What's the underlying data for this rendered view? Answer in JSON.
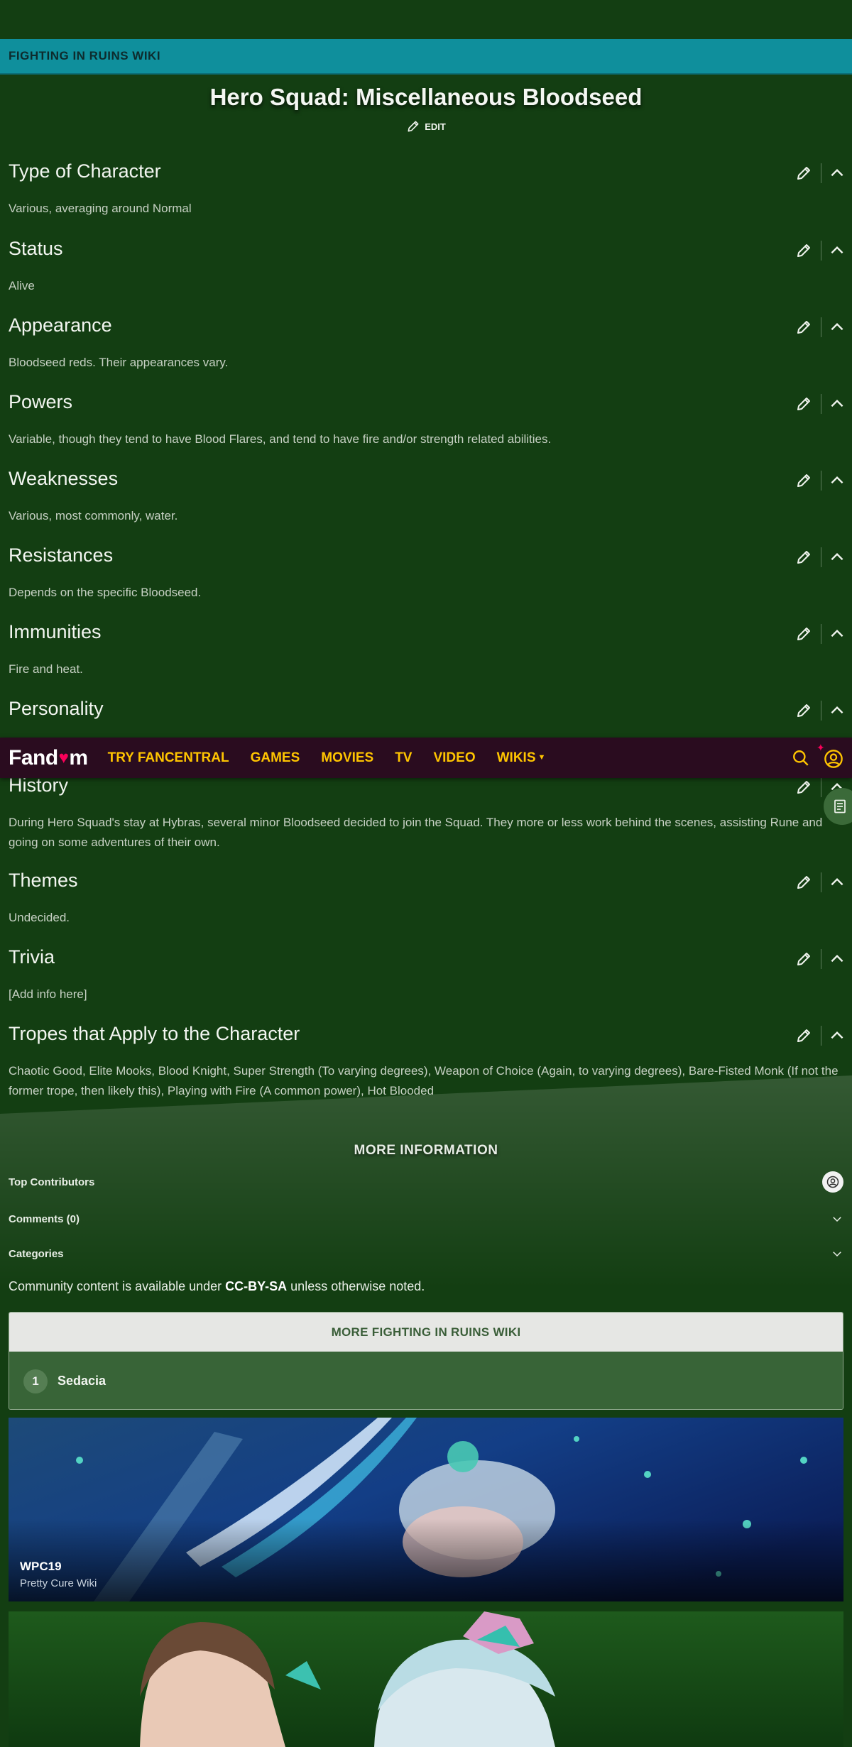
{
  "wiki": {
    "name": "FIGHTING IN RUINS WIKI"
  },
  "page": {
    "title": "Hero Squad: Miscellaneous Bloodseed",
    "edit_label": "EDIT"
  },
  "sections": [
    {
      "title": "Type of Character",
      "body": "Various, averaging around Normal"
    },
    {
      "title": "Status",
      "body": "Alive"
    },
    {
      "title": "Appearance",
      "body": "Bloodseed reds. Their appearances vary."
    },
    {
      "title": "Powers",
      "body": "Variable, though they tend to have Blood Flares, and tend to have fire and/or strength related abilities."
    },
    {
      "title": "Weaknesses",
      "body": "Various, most commonly, water."
    },
    {
      "title": "Resistances",
      "body": "Depends on the specific Bloodseed."
    },
    {
      "title": "Immunities",
      "body": "Fire and heat."
    },
    {
      "title": "Personality",
      "body": ""
    },
    {
      "title": "History",
      "body": "During Hero Squad's stay at Hybras, several minor Bloodseed decided to join the Squad. They more or less work behind the scenes, assisting Rune and going on some adventures of their own."
    },
    {
      "title": "Themes",
      "body": "Undecided."
    },
    {
      "title": "Trivia",
      "body": "[Add info here]"
    },
    {
      "title": "Tropes that Apply to the Character",
      "body": "Chaotic Good, Elite Mooks, Blood Knight, Super Strength (To varying degrees), Weapon of Choice (Again, to varying degrees), Bare-Fisted Monk (If not the former trope, then likely this), Playing with Fire (A common power), Hot Blooded"
    }
  ],
  "fandom_nav": {
    "logo_left": "Fand",
    "logo_right": "m",
    "items": [
      "TRY FANCENTRAL",
      "GAMES",
      "MOVIES",
      "TV",
      "VIDEO",
      "WIKIS"
    ]
  },
  "more_info": {
    "heading": "MORE INFORMATION",
    "top_contributors": "Top Contributors",
    "comments": "Comments (0)",
    "categories": "Categories"
  },
  "license": {
    "prefix": "Community content is available under ",
    "link": "CC-BY-SA",
    "suffix": " unless otherwise noted."
  },
  "more_wiki": {
    "heading": "MORE FIGHTING IN RUINS WIKI",
    "items": [
      {
        "number": "1",
        "label": "Sedacia"
      }
    ]
  },
  "cards": [
    {
      "title": "WPC19",
      "subtitle": "Pretty Cure Wiki"
    }
  ],
  "colors": {
    "page_bg": "#133e12",
    "wiki_bar": "#0f8f9c",
    "fandom_bar": "#2a0c1f",
    "fandom_accent": "#ffc500",
    "fandom_heart": "#fa005a"
  }
}
